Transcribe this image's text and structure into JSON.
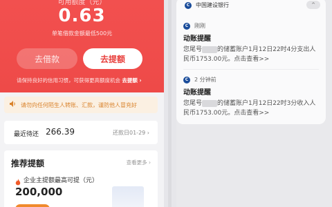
{
  "left": {
    "hero": {
      "top_text": "可用额度（元）",
      "amount": "0.63",
      "subtitle": "单笔借款金额最低500元",
      "borrow_button": "去借款",
      "raise_button": "去提额",
      "tip_text": "请保持良好的信用习惯，可获得更高额度机会",
      "tip_link": "去提额 ›"
    },
    "notice": {
      "icon": "speaker-icon",
      "text": "请勿向任何陌生人转账、汇款，谨防他人冒充好"
    },
    "repayment": {
      "label": "最近待还",
      "value": "266.39",
      "due": "还款日01-29 ›"
    },
    "recommend": {
      "title": "推荐提额",
      "more": "查看更多 ›",
      "item_title": "企业主提额最高可提（元）",
      "item_amount": "200,000"
    }
  },
  "right": {
    "bank_name": "中国建设银行",
    "notifications": [
      {
        "time": "刚刚",
        "title": "动账提醒",
        "body_prefix": "您尾号",
        "body_suffix": "的储蓄账户1月12日22时4分支出人民币1753.00元。点击查看>>"
      },
      {
        "time": "2 分钟前",
        "title": "动账提醒",
        "body_prefix": "您尾号",
        "body_suffix": "的储蓄账户1月12日22时3分收入人民币1753.00元。点击查看>>"
      }
    ]
  },
  "colors": {
    "hero_red": "#ef4d4b",
    "notice_orange": "#d9822b",
    "bank_blue": "#1a4c9a"
  }
}
